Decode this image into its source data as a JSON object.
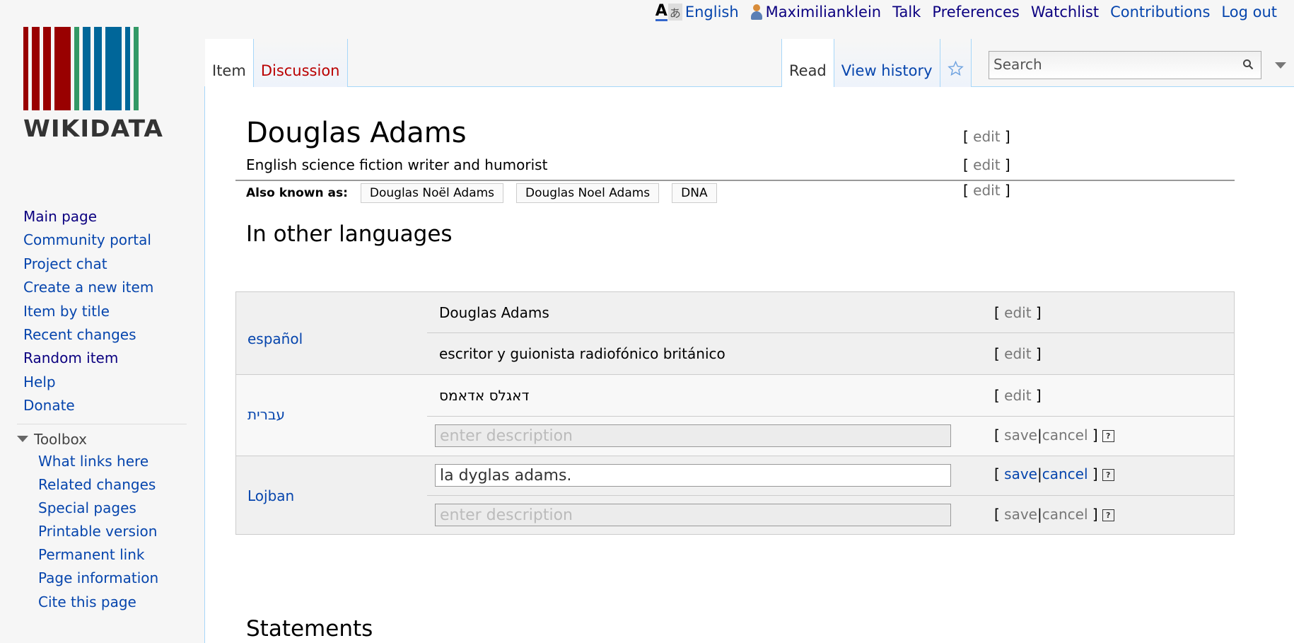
{
  "personal": {
    "language": "English",
    "username": "Maximilianklein",
    "talk": "Talk",
    "preferences": "Preferences",
    "watchlist": "Watchlist",
    "contributions": "Contributions",
    "logout": "Log out"
  },
  "logo": {
    "wordmark": "WIKIDATA",
    "bar_colors": [
      "#990000",
      "#990000",
      "#990000",
      "#990000",
      "#339966",
      "#006699",
      "#006699",
      "#006699",
      "#006699",
      "#339966"
    ]
  },
  "nav": {
    "items": [
      "Main page",
      "Community portal",
      "Project chat",
      "Create a new item",
      "Item by title",
      "Recent changes",
      "Random item",
      "Help",
      "Donate"
    ]
  },
  "toolbox": {
    "heading": "Toolbox",
    "items": [
      "What links here",
      "Related changes",
      "Special pages",
      "Printable version",
      "Permanent link",
      "Page information",
      "Cite this page"
    ]
  },
  "tabs": {
    "item": "Item",
    "discussion": "Discussion",
    "read": "Read",
    "history": "View history"
  },
  "search": {
    "placeholder": "Search"
  },
  "entity": {
    "label": "Douglas Adams",
    "description": "English science fiction writer and humorist",
    "aliases_label": "Also known as:",
    "aliases": [
      "Douglas Noël Adams",
      "Douglas Noel Adams",
      "DNA"
    ]
  },
  "common": {
    "edit": "edit",
    "save": "save",
    "cancel": "cancel",
    "help": "?",
    "desc_placeholder": "enter description"
  },
  "other_languages": {
    "heading": "In other languages",
    "rows": [
      {
        "language": "español",
        "label": "Douglas Adams",
        "description": "escritor y guionista radiofónico británico"
      },
      {
        "language": "עברית",
        "label": "דאגלס אדאמס",
        "description": ""
      },
      {
        "language": "Lojban",
        "label": "la dyglas adams.",
        "description": ""
      }
    ]
  },
  "statements": {
    "heading": "Statements"
  },
  "colors": {
    "link": "#0645ad",
    "visited": "#0b0080",
    "tab_border": "#a7d7f9",
    "discussion_red": "#ba0000"
  }
}
